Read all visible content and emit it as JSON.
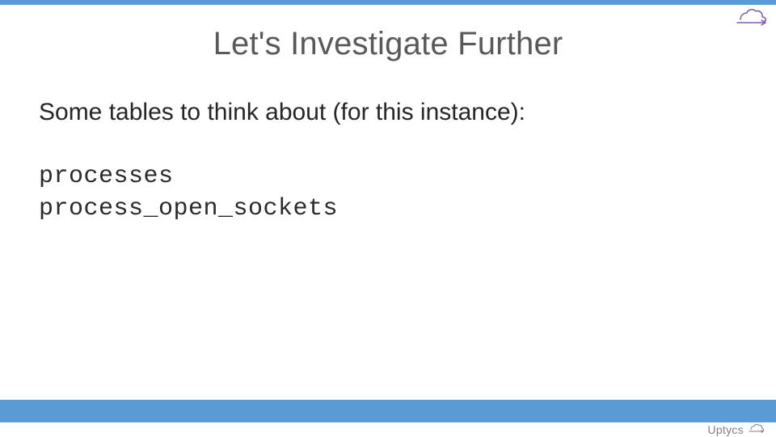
{
  "slide": {
    "title": "Let's Investigate Further",
    "intro": "Some tables to think about (for this instance):",
    "code_lines": [
      "processes",
      "process_open_sockets"
    ]
  },
  "brand": {
    "name": "Uptycs"
  }
}
